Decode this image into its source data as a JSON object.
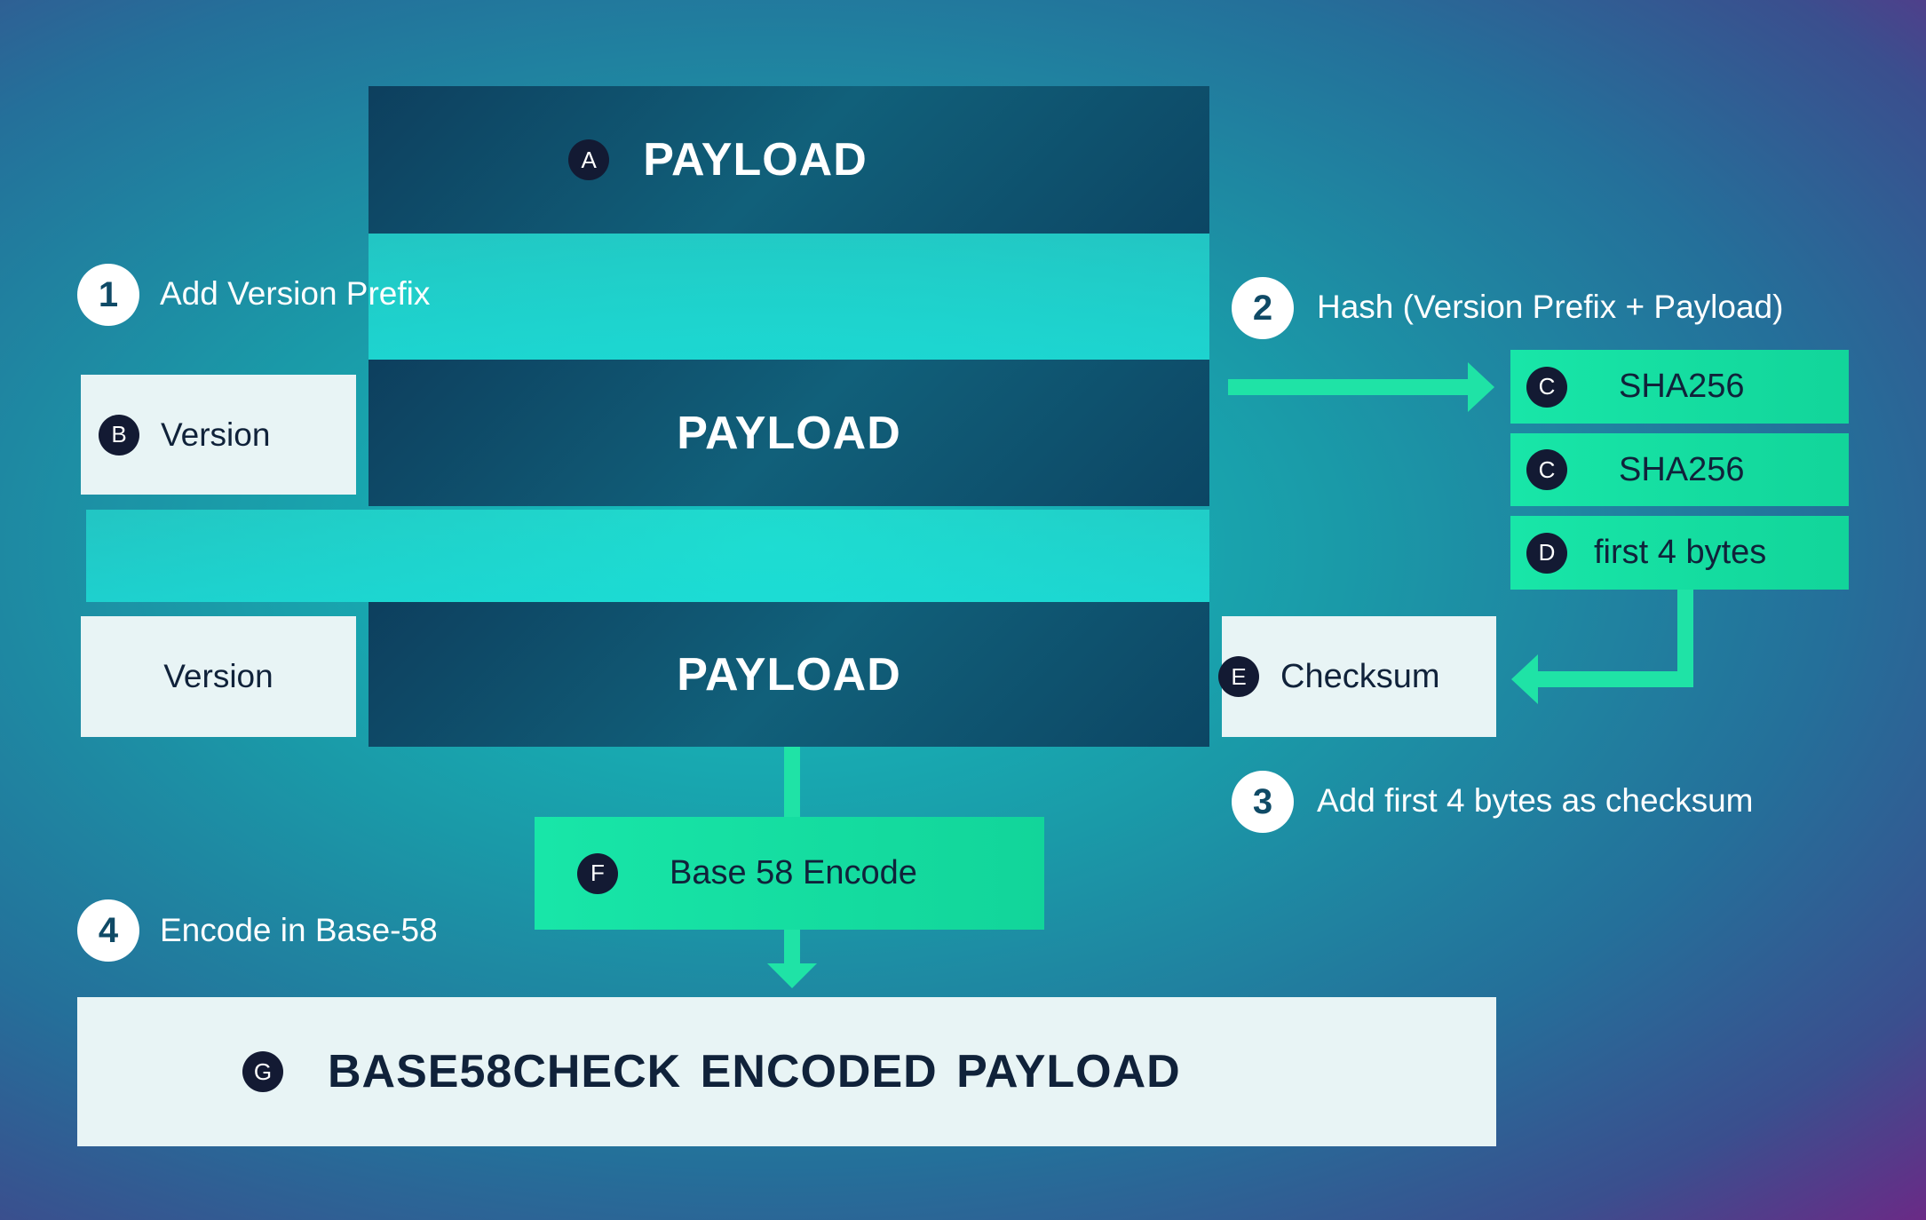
{
  "colors": {
    "accent_green": "#1fe3a6",
    "dark_block": "#0d3f5e",
    "light_block": "#e8f4f5",
    "badge": "#131a33"
  },
  "blocks": {
    "payload_a": {
      "badge": "A",
      "label": "PAYLOAD"
    },
    "version_b": {
      "badge": "B",
      "label": "Version"
    },
    "payload_mid": {
      "label": "PAYLOAD"
    },
    "version_bottom": {
      "label": "Version"
    },
    "payload_bottom": {
      "label": "PAYLOAD"
    },
    "checksum": {
      "badge": "E",
      "label": "Checksum"
    },
    "sha1": {
      "badge": "C",
      "label": "SHA256"
    },
    "sha2": {
      "badge": "C",
      "label": "SHA256"
    },
    "first4": {
      "badge": "D",
      "label": "first 4 bytes"
    },
    "encode": {
      "badge": "F",
      "label": "Base 58 Encode"
    },
    "result": {
      "badge": "G",
      "label": "BASE58CHECK ENCODED PAYLOAD"
    }
  },
  "steps": [
    {
      "num": "1",
      "label": "Add Version Prefix"
    },
    {
      "num": "2",
      "label": "Hash (Version Prefix + Payload)"
    },
    {
      "num": "3",
      "label": "Add first 4 bytes as checksum"
    },
    {
      "num": "4",
      "label": "Encode in Base-58"
    }
  ]
}
